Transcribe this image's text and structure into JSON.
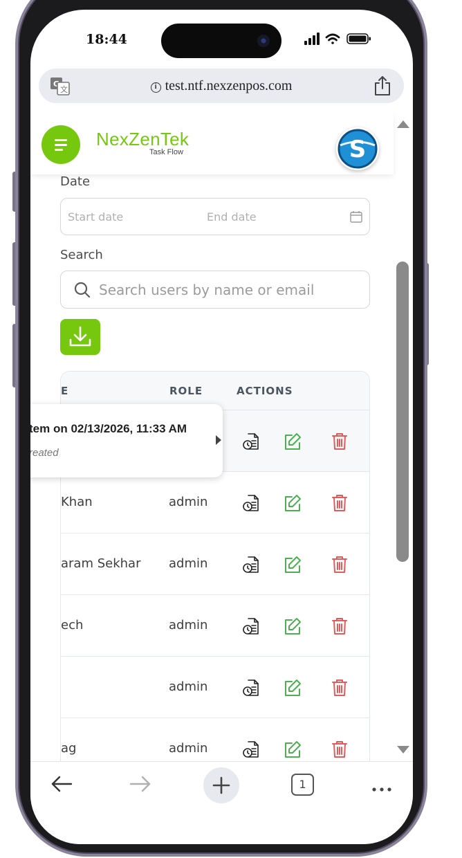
{
  "status_bar": {
    "time": "18:44"
  },
  "browser": {
    "url": "test.ntf.nexzenpos.com",
    "info_glyph": "i",
    "tab_count": "1"
  },
  "brand": {
    "logo": "NexZenTek",
    "tagline": "Task Flow",
    "avatar_letter": "S",
    "accent": "#76c80f"
  },
  "filters": {
    "date_label": "Date",
    "start_placeholder": "Start date",
    "end_placeholder": "End date",
    "search_label": "Search",
    "search_placeholder": "Search users by name or email"
  },
  "table": {
    "headers": [
      "E",
      "ROLE",
      "ACTIONS"
    ],
    "rows": [
      {
        "name": "",
        "role": ""
      },
      {
        "name": "Khan",
        "role": "admin"
      },
      {
        "name": "aram Sekhar",
        "role": "admin"
      },
      {
        "name": "ech",
        "role": "admin"
      },
      {
        "name": "",
        "role": "admin"
      },
      {
        "name": "ag",
        "role": "admin"
      }
    ]
  },
  "tooltip": {
    "title": "tem on 02/13/2026, 11:33 AM",
    "subtitle": "reated"
  },
  "icons": {
    "history": "history-icon",
    "edit": "edit-icon",
    "delete": "trash-icon",
    "edit_color": "#4caf50",
    "delete_color": "#e25b5b"
  }
}
